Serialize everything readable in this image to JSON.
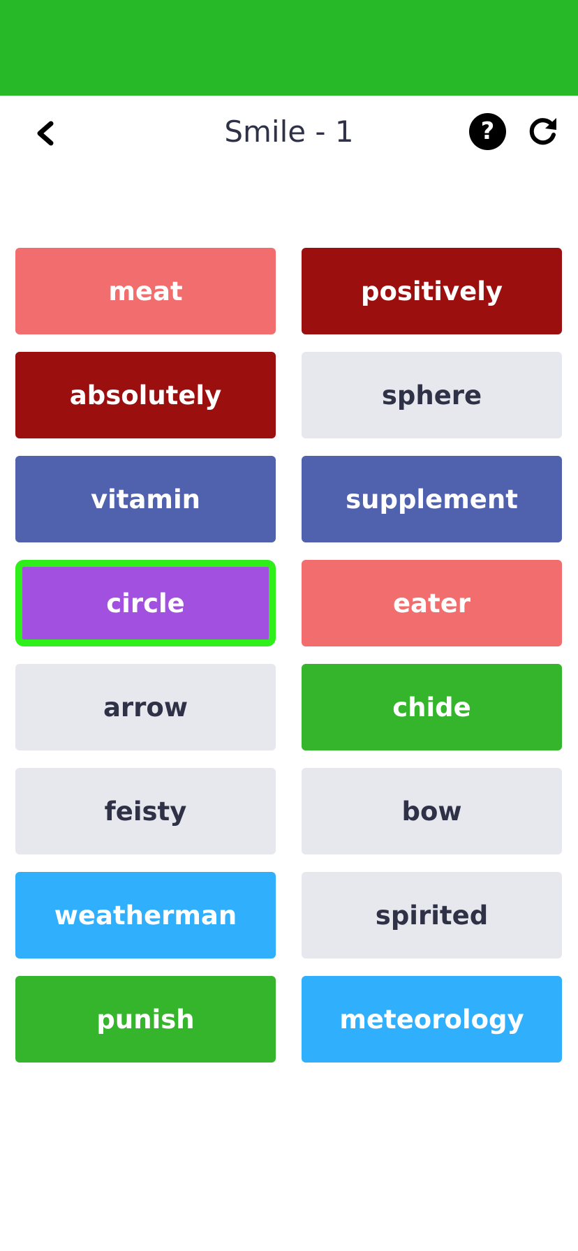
{
  "header": {
    "title": "Smile - 1",
    "back_icon": "chevron-left-icon",
    "help_label": "?",
    "help_icon": "help-circle-icon",
    "refresh_icon": "refresh-icon"
  },
  "colors": {
    "status_band": "#27b927",
    "salmon": "#f26d6d",
    "dark_red": "#9b0f0f",
    "blue": "#5061ad",
    "purple": "#a150e0",
    "green": "#34b52c",
    "sky": "#30b0fc",
    "gray": "#e7e8ee",
    "selected_border": "#2eef19",
    "dark_text": "#2f3147"
  },
  "tiles": [
    {
      "word": "meat",
      "bg": "#f26d6d",
      "fg": "#ffffff",
      "selected": false
    },
    {
      "word": "positively",
      "bg": "#9b0f0f",
      "fg": "#ffffff",
      "selected": false
    },
    {
      "word": "absolutely",
      "bg": "#9b0f0f",
      "fg": "#ffffff",
      "selected": false
    },
    {
      "word": "sphere",
      "bg": "#e7e8ee",
      "fg": "#2f3147",
      "selected": false
    },
    {
      "word": "vitamin",
      "bg": "#5061ad",
      "fg": "#ffffff",
      "selected": false
    },
    {
      "word": "supplement",
      "bg": "#5061ad",
      "fg": "#ffffff",
      "selected": false
    },
    {
      "word": "circle",
      "bg": "#a150e0",
      "fg": "#ffffff",
      "selected": true
    },
    {
      "word": "eater",
      "bg": "#f26d6d",
      "fg": "#ffffff",
      "selected": false
    },
    {
      "word": "arrow",
      "bg": "#e7e8ee",
      "fg": "#2f3147",
      "selected": false
    },
    {
      "word": "chide",
      "bg": "#34b52c",
      "fg": "#ffffff",
      "selected": false
    },
    {
      "word": "feisty",
      "bg": "#e7e8ee",
      "fg": "#2f3147",
      "selected": false
    },
    {
      "word": "bow",
      "bg": "#e7e8ee",
      "fg": "#2f3147",
      "selected": false
    },
    {
      "word": "weatherman",
      "bg": "#30b0fc",
      "fg": "#ffffff",
      "selected": false
    },
    {
      "word": "spirited",
      "bg": "#e7e8ee",
      "fg": "#2f3147",
      "selected": false
    },
    {
      "word": "punish",
      "bg": "#34b52c",
      "fg": "#ffffff",
      "selected": false
    },
    {
      "word": "meteorology",
      "bg": "#30b0fc",
      "fg": "#ffffff",
      "selected": false
    }
  ]
}
